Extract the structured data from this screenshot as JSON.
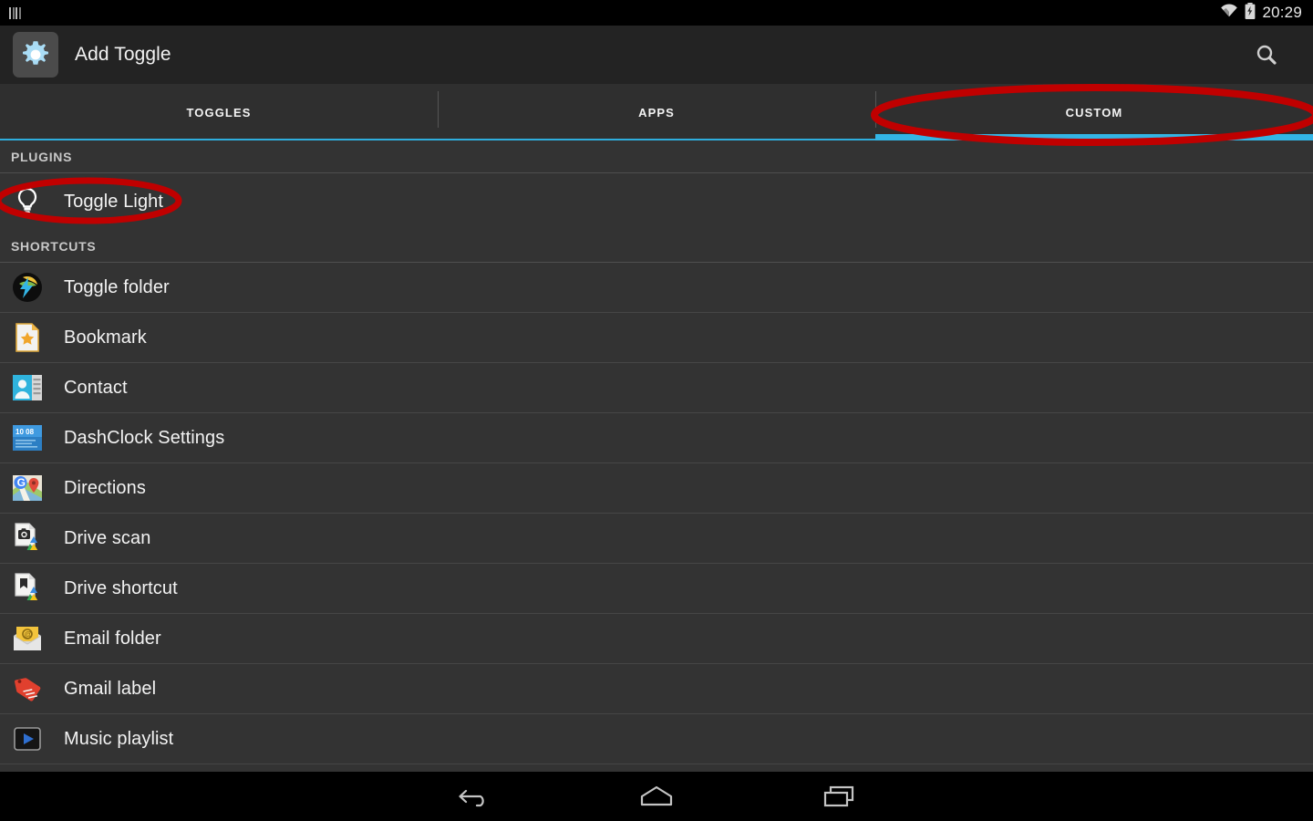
{
  "status_bar": {
    "notification_icon": "notification-bars-icon",
    "wifi_icon": "wifi-icon",
    "battery_icon": "battery-charging-icon",
    "clock": "20:29"
  },
  "action_bar": {
    "app_icon": "gear-icon",
    "title": "Add Toggle",
    "search_icon": "search-icon"
  },
  "tabs": [
    {
      "label": "TOGGLES",
      "active": false
    },
    {
      "label": "APPS",
      "active": false
    },
    {
      "label": "CUSTOM",
      "active": true
    }
  ],
  "sections": [
    {
      "header": "PLUGINS",
      "items": [
        {
          "label": "Toggle Light",
          "icon": "lightbulb-icon",
          "highlighted": true
        }
      ]
    },
    {
      "header": "SHORTCUTS",
      "items": [
        {
          "label": "Toggle folder",
          "icon": "toggle-folder-icon",
          "highlighted": false
        },
        {
          "label": "Bookmark",
          "icon": "bookmark-star-icon",
          "highlighted": false
        },
        {
          "label": "Contact",
          "icon": "contact-card-icon",
          "highlighted": false
        },
        {
          "label": "DashClock Settings",
          "icon": "dashclock-icon",
          "highlighted": false
        },
        {
          "label": "Directions",
          "icon": "maps-directions-icon",
          "highlighted": false
        },
        {
          "label": "Drive scan",
          "icon": "drive-scan-icon",
          "highlighted": false
        },
        {
          "label": "Drive shortcut",
          "icon": "drive-shortcut-icon",
          "highlighted": false
        },
        {
          "label": "Email folder",
          "icon": "email-folder-icon",
          "highlighted": false
        },
        {
          "label": "Gmail label",
          "icon": "gmail-label-icon",
          "highlighted": false
        },
        {
          "label": "Music playlist",
          "icon": "music-playlist-icon",
          "highlighted": false
        }
      ]
    }
  ],
  "nav_bar": {
    "back": "back-icon",
    "home": "home-icon",
    "recents": "recents-icon"
  },
  "annotations": [
    {
      "name": "custom-tab-highlight",
      "shape": "ellipse",
      "color": "#c00000"
    },
    {
      "name": "toggle-light-highlight",
      "shape": "ellipse",
      "color": "#c00000"
    }
  ],
  "colors": {
    "accent": "#33b5e5",
    "action_bar_bg": "#232323",
    "list_bg": "#333333",
    "annotation_red": "#c00000"
  }
}
